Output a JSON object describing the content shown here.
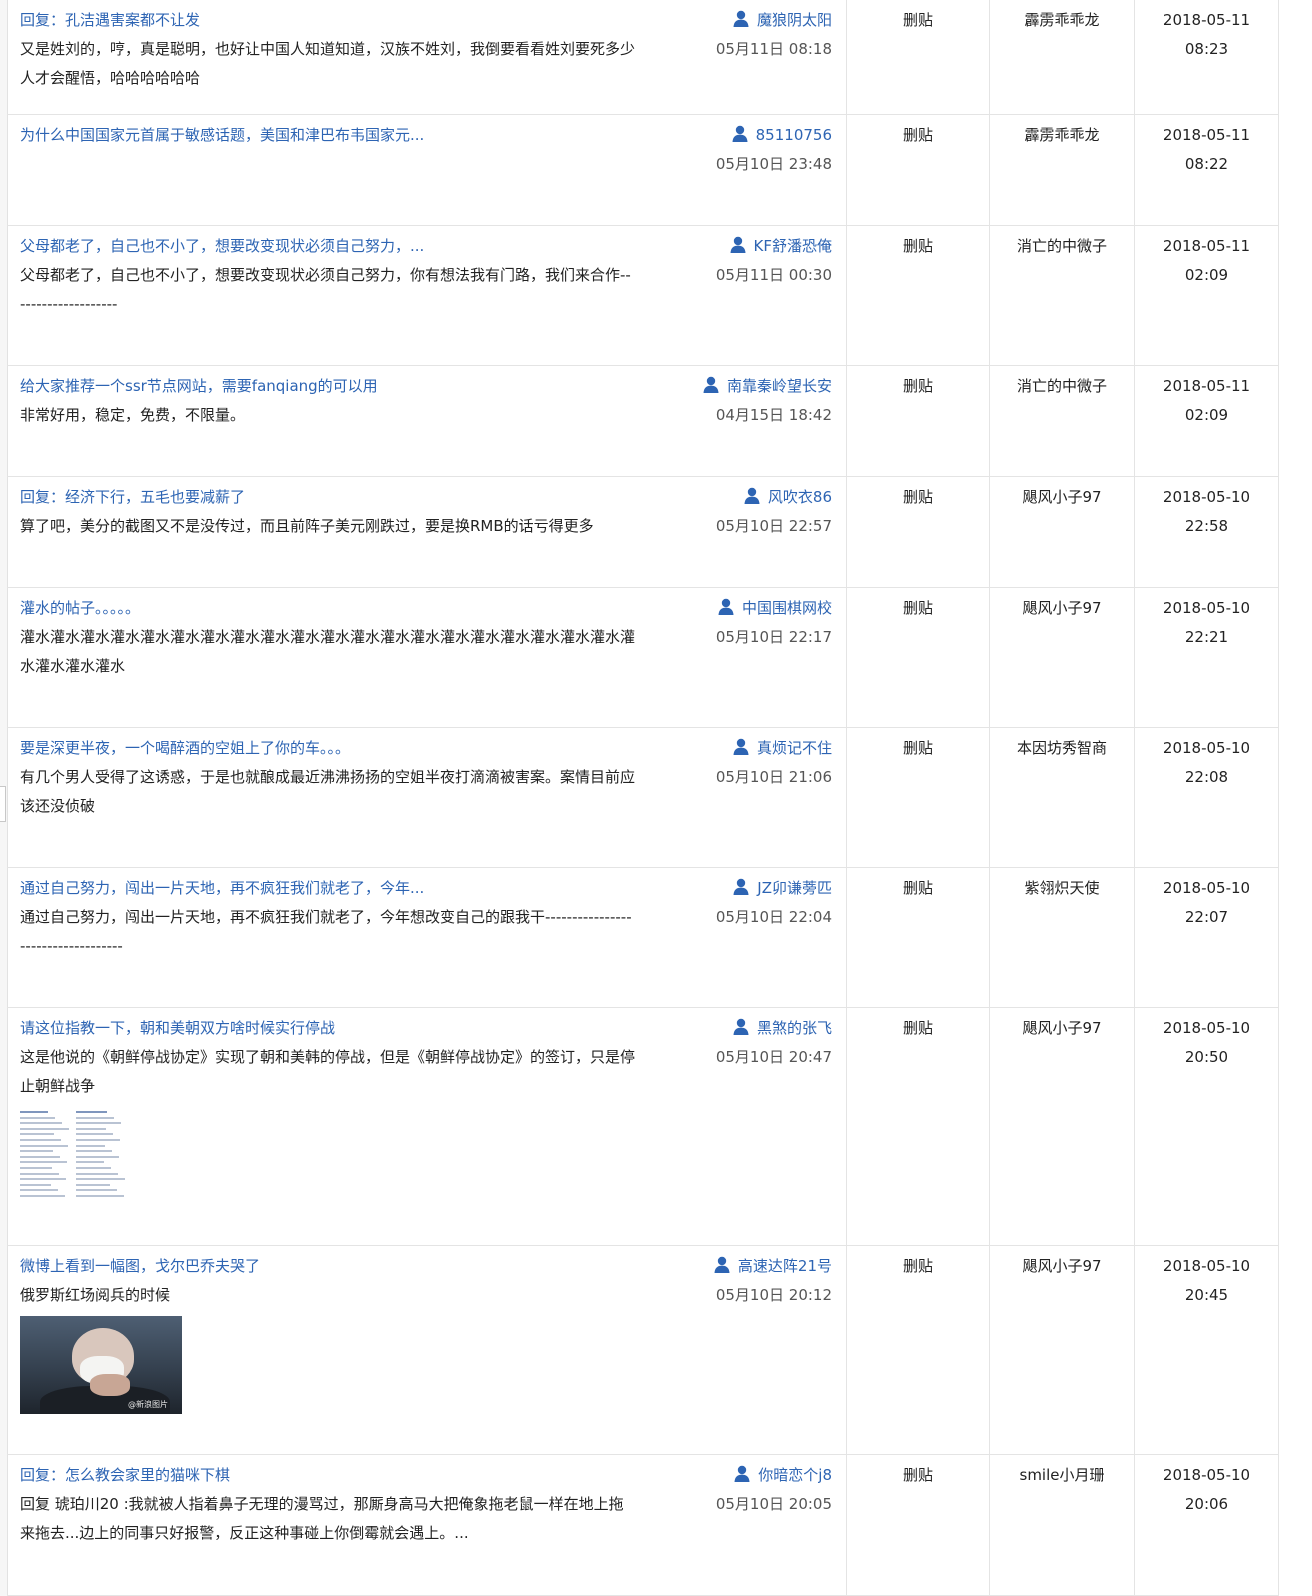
{
  "op_label": "删贴",
  "rows": [
    {
      "title": "回复：孔洁遇害案都不让发",
      "excerpt": "又是姓刘的，哼，真是聪明，也好让中国人知道知道，汉族不姓刘，我倒要看看姓刘要死多少人才会醒悟，哈哈哈哈哈哈",
      "author": "魔狼阴太阳",
      "post_time": "05月11日 08:18",
      "moderator": "霹雳乖乖龙",
      "date": "2018-05-11",
      "time": "08:23",
      "media": "none"
    },
    {
      "title": "为什么中国国家元首属于敏感话题，美国和津巴布韦国家元...",
      "excerpt": "",
      "author": "85110756",
      "post_time": "05月10日 23:48",
      "moderator": "霹雳乖乖龙",
      "date": "2018-05-11",
      "time": "08:22",
      "media": "none"
    },
    {
      "title": "父母都老了，自己也不小了，想要改变现状必须自己努力，...",
      "excerpt": "父母都老了，自己也不小了，想要改变现状必须自己努力，你有想法我有门路，我们来合作--------------------",
      "author": "KF舒潘恐俺",
      "post_time": "05月11日 00:30",
      "moderator": "消亡的中微子",
      "date": "2018-05-11",
      "time": "02:09",
      "media": "none"
    },
    {
      "title": "给大家推荐一个ssr节点网站，需要fanqiang的可以用",
      "excerpt": "非常好用，稳定，免费，不限量。",
      "author": "南靠秦岭望长安",
      "post_time": "04月15日 18:42",
      "moderator": "消亡的中微子",
      "date": "2018-05-11",
      "time": "02:09",
      "media": "none"
    },
    {
      "title": "回复：经济下行，五毛也要减薪了",
      "excerpt": "算了吧，美分的截图又不是没传过，而且前阵子美元刚跌过，要是换RMB的话亏得更多",
      "author": "风吹衣86",
      "post_time": "05月10日 22:57",
      "moderator": "飓风小子97",
      "date": "2018-05-10",
      "time": "22:58",
      "media": "none"
    },
    {
      "title": "灌水的帖子。。。。。",
      "excerpt": "灌水灌水灌水灌水灌水灌水灌水灌水灌水灌水灌水灌水灌水灌水灌水灌水灌水灌水灌水灌水灌水灌水灌水灌水",
      "author": "中国围棋网校",
      "post_time": "05月10日 22:17",
      "moderator": "飓风小子97",
      "date": "2018-05-10",
      "time": "22:21",
      "media": "none"
    },
    {
      "title": "要是深更半夜，一个喝醉酒的空姐上了你的车。。。",
      "excerpt": "有几个男人受得了这诱惑，于是也就酿成最近沸沸扬扬的空姐半夜打滴滴被害案。案情目前应该还没侦破",
      "author": "真烦记不住",
      "post_time": "05月10日 21:06",
      "moderator": "本因坊秀智商",
      "date": "2018-05-10",
      "time": "22:08",
      "media": "none"
    },
    {
      "title": "通过自己努力，闯出一片天地，再不疯狂我们就老了，今年...",
      "excerpt": "通过自己努力，闯出一片天地，再不疯狂我们就老了，今年想改变自己的跟我干-----------------------------------",
      "author": "JZ卯谦蒡匹",
      "post_time": "05月10日 22:04",
      "moderator": "紫翎炽天使",
      "date": "2018-05-10",
      "time": "22:07",
      "media": "none"
    },
    {
      "title": "请这位指教一下，朝和美朝双方啥时候实行停战",
      "excerpt": "这是他说的《朝鲜停战协定》实现了朝和美韩的停战，但是《朝鲜停战协定》的签订，只是停止朝鲜战争",
      "author": "黑煞的张飞",
      "post_time": "05月10日 20:47",
      "moderator": "飓风小子97",
      "date": "2018-05-10",
      "time": "20:50",
      "media": "doc"
    },
    {
      "title": "微博上看到一幅图，戈尔巴乔夫哭了",
      "excerpt": "俄罗斯红场阅兵的时候",
      "author": "高速达阵21号",
      "post_time": "05月10日 20:12",
      "moderator": "飓风小子97",
      "date": "2018-05-10",
      "time": "20:45",
      "media": "photo",
      "photo_watermark": "@新浪图片"
    },
    {
      "title": "回复：怎么教会家里的猫咪下棋",
      "excerpt": "回复 琥珀川20 :我就被人指着鼻子无理的漫骂过，那厮身高马大把俺象拖老鼠一样在地上拖来拖去...边上的同事只好报警，反正这种事碰上你倒霉就会遇上。...",
      "author": "你暗恋个j8",
      "post_time": "05月10日 20:05",
      "moderator": "smile小月珊",
      "date": "2018-05-10",
      "time": "20:06",
      "media": "none"
    }
  ]
}
